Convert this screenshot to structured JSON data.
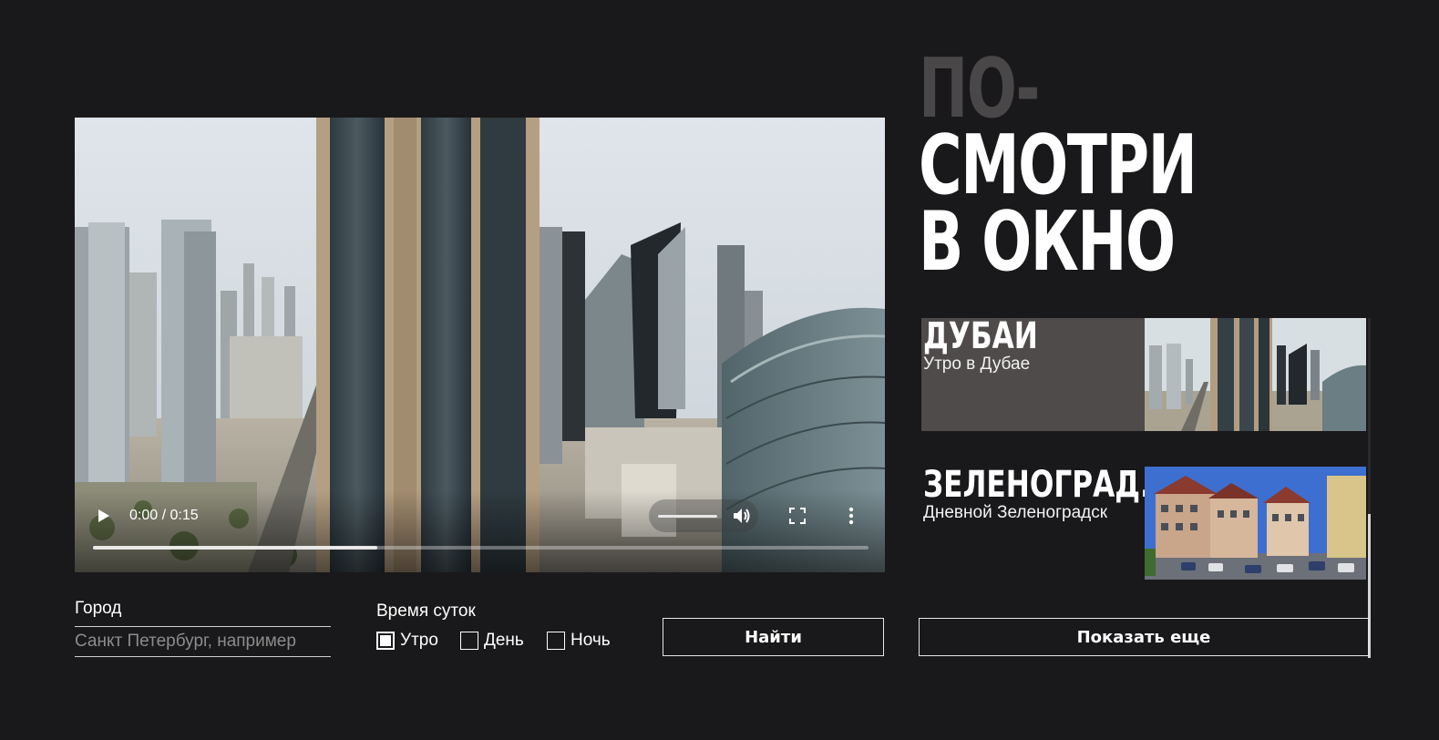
{
  "player": {
    "time_display": "0:00 / 0:15",
    "progress_fraction": 0.367
  },
  "heading": {
    "line1": "ПО-",
    "line2": "СМОТРИ",
    "line3": "В ОКНО"
  },
  "cards": [
    {
      "city": "ДУБАИ",
      "description": "Утро в Дубае"
    },
    {
      "city": "ЗЕЛЕНОГРАД...",
      "description": "Дневной Зеленоградск"
    }
  ],
  "search_form": {
    "city_label": "Город",
    "city_placeholder": "Санкт Петербург, например",
    "time_label": "Время суток",
    "options": [
      {
        "label": "Утро",
        "checked": true
      },
      {
        "label": "День",
        "checked": false
      },
      {
        "label": "Ночь",
        "checked": false
      }
    ],
    "search_button": "Найти"
  },
  "show_more_button": "Показать еще",
  "colors": {
    "background": "#19181a",
    "card_highlight": "#4f4b4b",
    "heading_dim": "#4a4748"
  }
}
